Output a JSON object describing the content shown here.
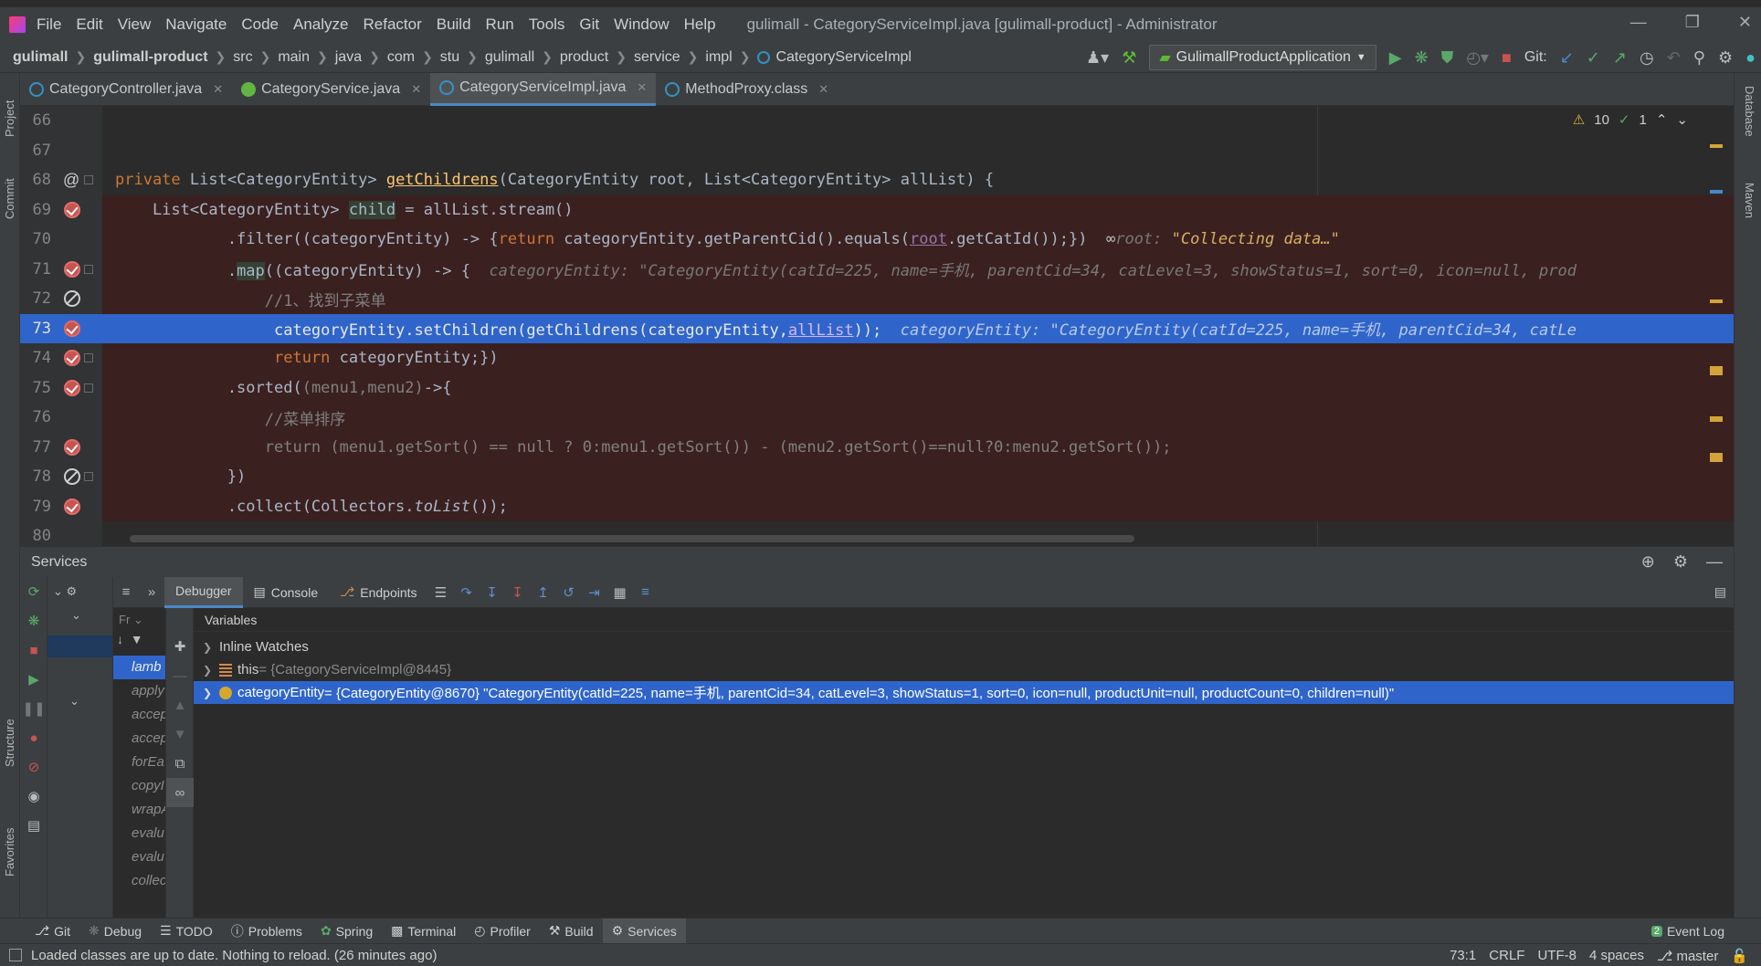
{
  "menubar": {
    "items": [
      "File",
      "Edit",
      "View",
      "Navigate",
      "Code",
      "Analyze",
      "Refactor",
      "Build",
      "Run",
      "Tools",
      "Git",
      "Window",
      "Help"
    ],
    "title": "gulimall - CategoryServiceImpl.java [gulimall-product] - Administrator"
  },
  "breadcrumb": [
    "gulimall",
    "gulimall-product",
    "src",
    "main",
    "java",
    "com",
    "stu",
    "gulimall",
    "product",
    "service",
    "impl",
    "CategoryServiceImpl"
  ],
  "toolbar": {
    "run_config": "GulimallProductApplication",
    "git_label": "Git:"
  },
  "tabs": [
    {
      "label": "CategoryController.java",
      "color": "#3592c4"
    },
    {
      "label": "CategoryService.java",
      "color": "#62b543"
    },
    {
      "label": "CategoryServiceImpl.java",
      "color": "#3592c4"
    },
    {
      "label": "MethodProxy.class",
      "color": "#3592c4"
    }
  ],
  "inspections": {
    "warnings": "10",
    "ok": "1"
  },
  "editor": {
    "lines": [
      {
        "num": "66"
      },
      {
        "num": "67"
      },
      {
        "num": "68"
      },
      {
        "num": "69"
      },
      {
        "num": "70"
      },
      {
        "num": "71"
      },
      {
        "num": "72"
      },
      {
        "num": "73"
      },
      {
        "num": "74"
      },
      {
        "num": "75"
      },
      {
        "num": "76"
      },
      {
        "num": "77"
      },
      {
        "num": "78"
      },
      {
        "num": "79"
      },
      {
        "num": "80"
      }
    ],
    "line68": {
      "kw": "private ",
      "type1": "List<CategoryEntity> ",
      "fn": "getChildrens",
      "rest": "(CategoryEntity root, List<CategoryEntity> allList) {"
    },
    "line69": {
      "pre": "    List<CategoryEntity> ",
      "var": "child",
      "rest": " = allList.stream()"
    },
    "line70": {
      "pre": "            .filter((categoryEntity) -> {",
      "ret": "return ",
      "mid": "categoryEntity.getParentCid().equals(",
      "root": "root",
      "end": ".getCatId());})",
      "hint_label": "root: ",
      "hint_value": "\"Collecting data…\""
    },
    "line71": {
      "pre": "            .",
      "fn": "map",
      "rest": "((categoryEntity) -> {",
      "hint": "categoryEntity: \"CategoryEntity(catId=225, name=手机, parentCid=34, catLevel=3, showStatus=1, sort=0, icon=null, prod"
    },
    "line72": {
      "comment": "                //1、找到子菜单"
    },
    "line73": {
      "pre": "                 categoryEntity.setChildren(getChildrens(categoryEntity,",
      "ul": "allList",
      "end": "));",
      "hint": "categoryEntity: \"CategoryEntity(catId=225, name=手机, parentCid=34, catLe"
    },
    "line74": {
      "kw": "                 return ",
      "rest": "categoryEntity;})"
    },
    "line75": {
      "pre": "            .sorted(",
      "params": "(menu1,menu2)",
      "rest": "->{"
    },
    "line76": {
      "comment": "                //菜单排序"
    },
    "line77": {
      "code": "                return (menu1.getSort() == null ? 0:menu1.getSort()) - (menu2.getSort()==null?0:menu2.getSort());"
    },
    "line78": {
      "code": "            })"
    },
    "line79": {
      "pre": "            .collect(Collectors.",
      "it": "toList",
      "end": "());"
    }
  },
  "services": {
    "title": "Services",
    "debug_tabs": [
      "Debugger",
      "Console",
      "Endpoints"
    ],
    "frames_header": "Fr",
    "frames": [
      "lamb",
      "apply",
      "accep",
      "accep",
      "forEa",
      "copyI",
      "wrapA",
      "evalu",
      "evalu",
      "collec"
    ],
    "variables_header": "Variables",
    "vars": [
      {
        "label": "Inline Watches"
      },
      {
        "name": "this",
        "value": " = {CategoryServiceImpl@8445}"
      },
      {
        "name": "categoryEntity",
        "value": " = {CategoryEntity@8670} \"CategoryEntity(catId=225, name=手机, parentCid=34, catLevel=3, showStatus=1, sort=0, icon=null, productUnit=null, productCount=0, children=null)\""
      }
    ]
  },
  "bottom_tools": [
    "Git",
    "Debug",
    "TODO",
    "Problems",
    "Spring",
    "Terminal",
    "Profiler",
    "Build",
    "Services",
    "Event Log"
  ],
  "side_tools": {
    "left": [
      "Project",
      "Commit",
      "Structure",
      "Favorites"
    ],
    "right": [
      "Database",
      "Maven"
    ]
  },
  "status": {
    "message": "Loaded classes are up to date. Nothing to reload. (26 minutes ago)",
    "position": "73:1",
    "line_sep": "CRLF",
    "encoding": "UTF-8",
    "indent": "4 spaces",
    "branch": "master"
  }
}
